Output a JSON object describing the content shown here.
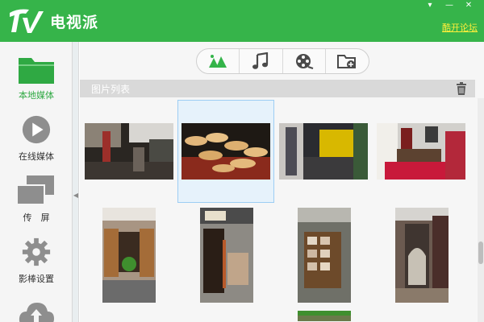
{
  "app": {
    "title": "电视派",
    "forum_link": "酷开论坛"
  },
  "window_controls": [
    {
      "name": "menu-icon",
      "label": "▾"
    },
    {
      "name": "minimize-icon",
      "label": "—"
    },
    {
      "name": "close-icon",
      "label": "✕"
    }
  ],
  "sidebar": {
    "items": [
      {
        "label": "本地媒体",
        "icon": "folder-icon",
        "active": true
      },
      {
        "label": "在线媒体",
        "icon": "play-icon",
        "active": false
      },
      {
        "label": "传　屏",
        "icon": "screen-cast-icon",
        "active": false
      },
      {
        "label": "影棒设置",
        "icon": "gear-icon",
        "active": false
      },
      {
        "label": "",
        "icon": "cloud-upload-icon",
        "active": false
      }
    ]
  },
  "tabs": [
    {
      "icon": "picture-icon",
      "active": true
    },
    {
      "icon": "music-icon",
      "active": false
    },
    {
      "icon": "video-reel-icon",
      "active": false
    },
    {
      "icon": "add-folder-icon",
      "active": false
    }
  ],
  "section": {
    "title": "图片列表"
  },
  "thumbnails": [
    {
      "name": "photo-street-market",
      "selected": false
    },
    {
      "name": "photo-flatbread-stall",
      "selected": true
    },
    {
      "name": "photo-yellow-crate",
      "selected": false
    },
    {
      "name": "photo-food-cart",
      "selected": false
    },
    {
      "name": "photo-wooden-door-plant",
      "selected": false
    },
    {
      "name": "photo-shop-doorway",
      "selected": false
    },
    {
      "name": "photo-photo-board-wall",
      "selected": false
    },
    {
      "name": "photo-alley-arch",
      "selected": false
    },
    {
      "name": "photo-partial",
      "selected": false
    }
  ],
  "colors": {
    "brand_green": "#36b44a",
    "link_yellow": "#ffef3a",
    "selection_blue": "#e6f2fb"
  }
}
